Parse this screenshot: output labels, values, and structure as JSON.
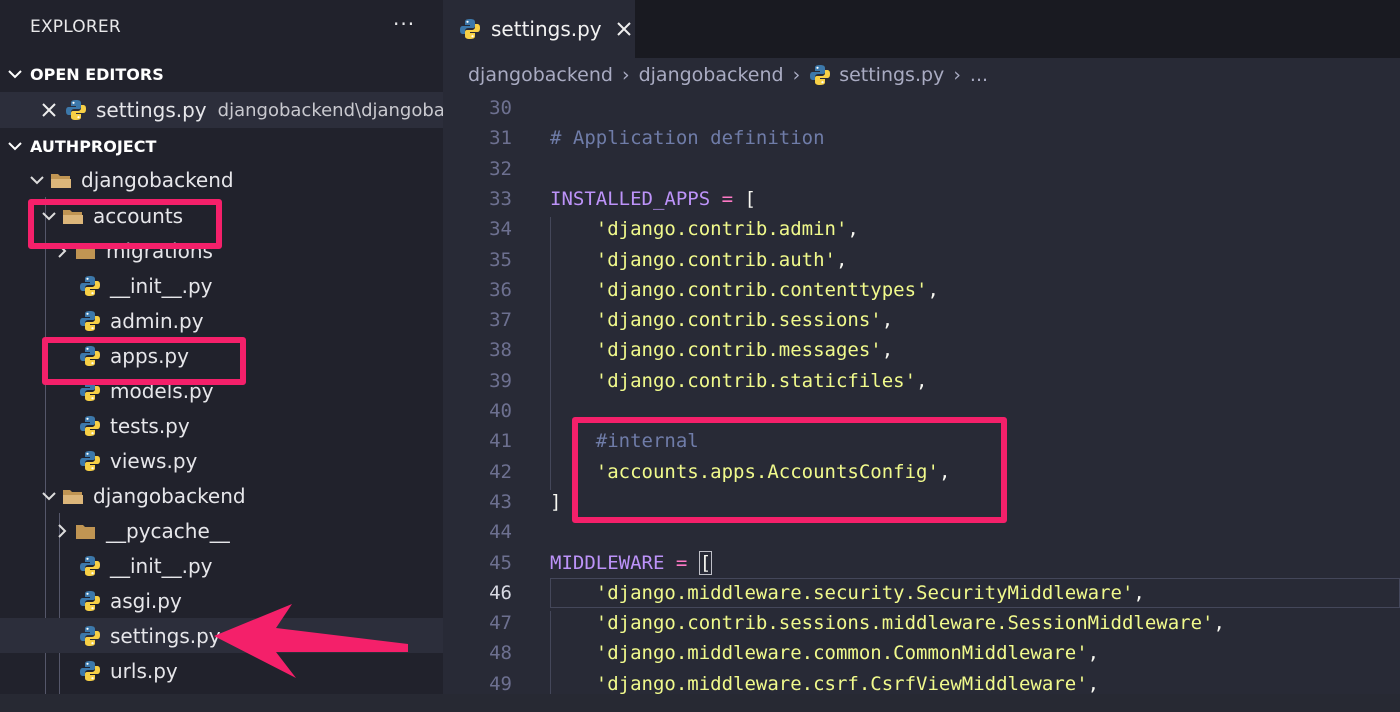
{
  "explorer": {
    "title": "EXPLORER",
    "more": "···",
    "open_editors": {
      "header": "OPEN EDITORS",
      "items": [
        {
          "name": "settings.py",
          "path": "djangobackend\\djangoba..."
        }
      ]
    },
    "project": {
      "header": "AUTHPROJECT",
      "tree": [
        {
          "label": "djangobackend",
          "type": "folder",
          "open": true
        },
        {
          "label": "accounts",
          "type": "folder",
          "open": true
        },
        {
          "label": "migrations",
          "type": "folder",
          "open": false
        },
        {
          "label": "__init__.py",
          "type": "python"
        },
        {
          "label": "admin.py",
          "type": "python"
        },
        {
          "label": "apps.py",
          "type": "python"
        },
        {
          "label": "models.py",
          "type": "python"
        },
        {
          "label": "tests.py",
          "type": "python"
        },
        {
          "label": "views.py",
          "type": "python"
        },
        {
          "label": "djangobackend",
          "type": "folder",
          "open": true
        },
        {
          "label": "__pycache__",
          "type": "folder",
          "open": false
        },
        {
          "label": "__init__.py",
          "type": "python"
        },
        {
          "label": "asgi.py",
          "type": "python"
        },
        {
          "label": "settings.py",
          "type": "python",
          "selected": true
        },
        {
          "label": "urls.py",
          "type": "python"
        }
      ]
    }
  },
  "editor": {
    "tab": {
      "label": "settings.py",
      "close": "✕"
    },
    "breadcrumb": [
      "djangobackend",
      "djangobackend",
      "settings.py",
      "..."
    ],
    "current_line": 46,
    "lines": [
      {
        "num": "30",
        "tokens": []
      },
      {
        "num": "31",
        "tokens": [
          {
            "t": "# Application definition",
            "c": "comment"
          }
        ]
      },
      {
        "num": "32",
        "tokens": []
      },
      {
        "num": "33",
        "tokens": [
          {
            "t": "INSTALLED_APPS",
            "c": "ident"
          },
          {
            "t": " = ",
            "c": "op"
          },
          {
            "t": "[",
            "c": "plain"
          }
        ]
      },
      {
        "num": "34",
        "tokens": [
          {
            "t": "    'django.contrib.admin'",
            "c": "str"
          },
          {
            "t": ",",
            "c": "plain"
          }
        ]
      },
      {
        "num": "35",
        "tokens": [
          {
            "t": "    'django.contrib.auth'",
            "c": "str"
          },
          {
            "t": ",",
            "c": "plain"
          }
        ]
      },
      {
        "num": "36",
        "tokens": [
          {
            "t": "    'django.contrib.contenttypes'",
            "c": "str"
          },
          {
            "t": ",",
            "c": "plain"
          }
        ]
      },
      {
        "num": "37",
        "tokens": [
          {
            "t": "    'django.contrib.sessions'",
            "c": "str"
          },
          {
            "t": ",",
            "c": "plain"
          }
        ]
      },
      {
        "num": "38",
        "tokens": [
          {
            "t": "    'django.contrib.messages'",
            "c": "str"
          },
          {
            "t": ",",
            "c": "plain"
          }
        ]
      },
      {
        "num": "39",
        "tokens": [
          {
            "t": "    'django.contrib.staticfiles'",
            "c": "str"
          },
          {
            "t": ",",
            "c": "plain"
          }
        ]
      },
      {
        "num": "40",
        "tokens": []
      },
      {
        "num": "41",
        "tokens": [
          {
            "t": "    #internal",
            "c": "comment"
          }
        ]
      },
      {
        "num": "42",
        "tokens": [
          {
            "t": "    'accounts.apps.AccountsConfig'",
            "c": "str"
          },
          {
            "t": ",",
            "c": "plain"
          }
        ]
      },
      {
        "num": "43",
        "tokens": [
          {
            "t": "]",
            "c": "plain"
          }
        ]
      },
      {
        "num": "44",
        "tokens": []
      },
      {
        "num": "45",
        "tokens": [
          {
            "t": "MIDDLEWARE",
            "c": "ident"
          },
          {
            "t": " = ",
            "c": "op"
          },
          {
            "t": "[",
            "c": "bracket"
          }
        ]
      },
      {
        "num": "46",
        "tokens": [
          {
            "t": "    'django.middleware.security.SecurityMiddleware'",
            "c": "str"
          },
          {
            "t": ",",
            "c": "plain"
          }
        ]
      },
      {
        "num": "47",
        "tokens": [
          {
            "t": "    'django.contrib.sessions.middleware.SessionMiddleware'",
            "c": "str"
          },
          {
            "t": ",",
            "c": "plain"
          }
        ]
      },
      {
        "num": "48",
        "tokens": [
          {
            "t": "    'django.middleware.common.CommonMiddleware'",
            "c": "str"
          },
          {
            "t": ",",
            "c": "plain"
          }
        ]
      },
      {
        "num": "49",
        "tokens": [
          {
            "t": "    'django.middleware.csrf.CsrfViewMiddleware'",
            "c": "str"
          },
          {
            "t": ",",
            "c": "plain"
          }
        ]
      }
    ]
  },
  "colors": {
    "annotation": "#f4206a",
    "python_blue": "#3c78aa",
    "python_yellow": "#f7d046",
    "folder": "#c09553"
  }
}
